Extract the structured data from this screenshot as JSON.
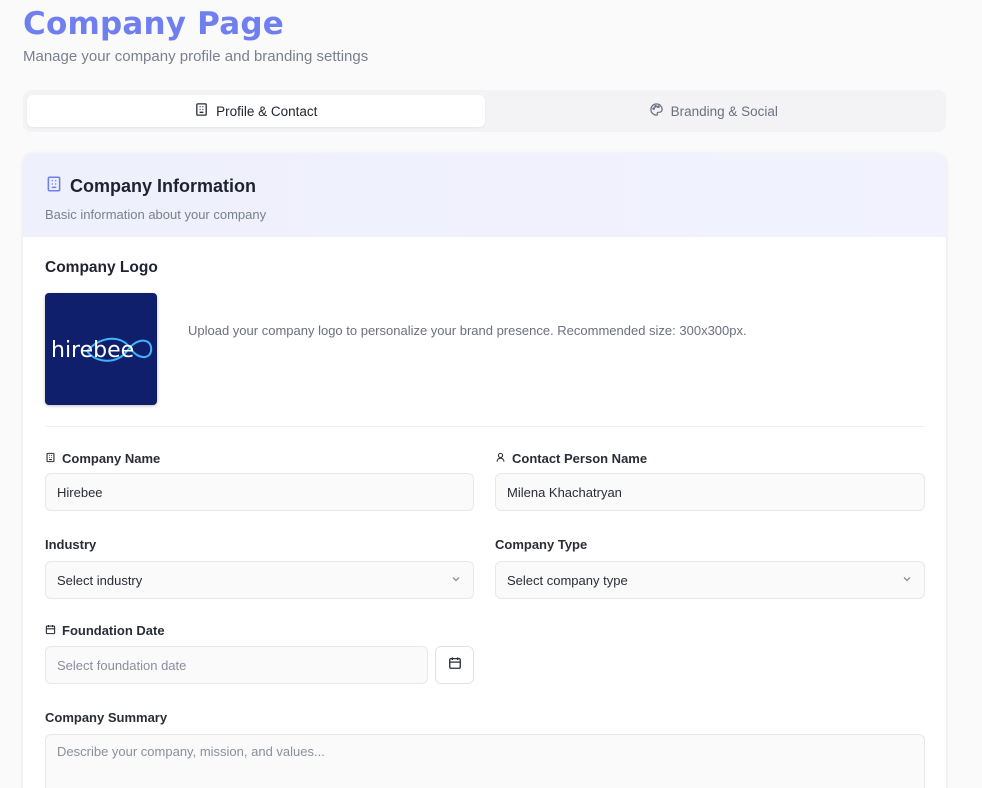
{
  "page": {
    "title": "Company Page",
    "subtitle": "Manage your company profile and branding settings"
  },
  "tabs": [
    {
      "label": "Profile & Contact",
      "icon": "building-icon",
      "active": true
    },
    {
      "label": "Branding & Social",
      "icon": "palette-icon",
      "active": false
    }
  ],
  "card": {
    "title": "Company Information",
    "subtitle": "Basic information about your company",
    "icon": "building-icon"
  },
  "logo": {
    "section_label": "Company Logo",
    "logo_text": "hirebee",
    "hint": "Upload your company logo to personalize your brand presence. Recommended size: 300x300px."
  },
  "fields": {
    "company_name": {
      "label": "Company Name",
      "value": "Hirebee",
      "icon": "building-icon"
    },
    "contact_person": {
      "label": "Contact Person Name",
      "value": "Milena Khachatryan",
      "icon": "user-icon"
    },
    "industry": {
      "label": "Industry",
      "value": "Select industry"
    },
    "company_type": {
      "label": "Company Type",
      "value": "Select company type"
    },
    "foundation_date": {
      "label": "Foundation Date",
      "placeholder": "Select foundation date",
      "icon": "calendar-icon"
    },
    "summary": {
      "label": "Company Summary",
      "placeholder": "Describe your company, mission, and values..."
    }
  },
  "colors": {
    "accent": "#6f7ff0",
    "logo_bg": "#0f1f6b",
    "header_bg": "#eef0fc"
  }
}
